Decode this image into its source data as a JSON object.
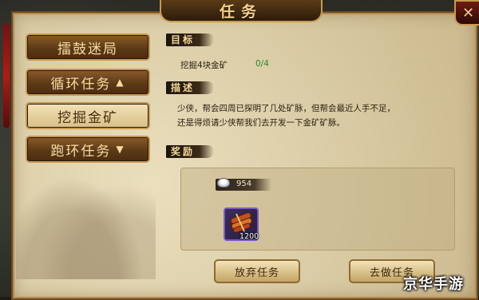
{
  "window": {
    "title": "任务",
    "close_glyph": "✕"
  },
  "sidebar": {
    "items": [
      {
        "label": "擂鼓迷局"
      },
      {
        "label": "循环任务",
        "arrow": "▲"
      },
      {
        "label": "挖掘金矿",
        "selected": true
      },
      {
        "label": "跑环任务",
        "arrow": "▼"
      }
    ]
  },
  "quest": {
    "goal_heading": "目标",
    "goal_text": "挖掘4块金矿",
    "goal_progress": "0/4",
    "desc_heading": "描述",
    "desc_line1": "少侠，帮会四周已探明了几处矿脉，但帮会最近人手不足，",
    "desc_line2": "还是得烦请少侠帮我们去开发一下金矿矿脉。",
    "reward_heading": "奖励",
    "silver_amount": "954",
    "item_quantity": "1200",
    "item_icon": "scroll-bundle-icon"
  },
  "actions": {
    "abandon_label": "放弃任务",
    "go_label": "去做任务"
  },
  "watermark": "京华手游",
  "colors": {
    "panel": "#d7c8a0",
    "accent_gold": "#c59650",
    "progress_green": "#2e8a2a",
    "item_border": "#7b5cc0"
  }
}
